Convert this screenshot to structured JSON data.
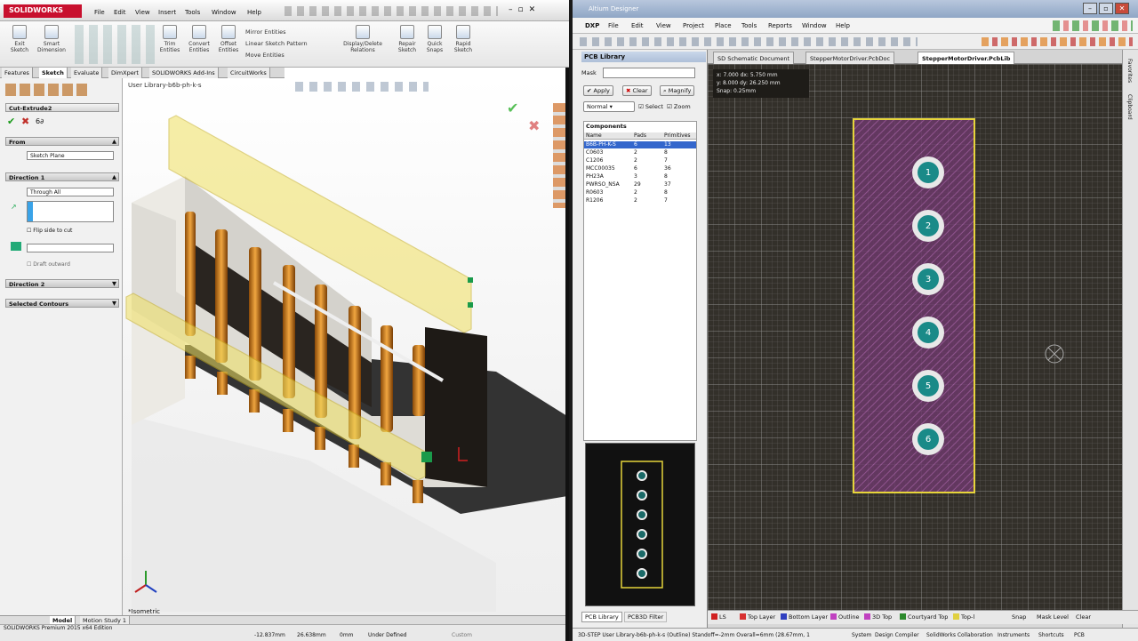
{
  "sw": {
    "logo": "SOLIDWORKS",
    "menus": [
      "File",
      "Edit",
      "View",
      "Insert",
      "Tools",
      "Window",
      "Help"
    ],
    "ribbon": [
      {
        "label": "Exit Sketch"
      },
      {
        "label": "Smart Dimension"
      },
      {
        "label": "Trim Entities"
      },
      {
        "label": "Convert Entities"
      },
      {
        "label": "Offset Entities"
      },
      {
        "label": "Mirror Entities"
      },
      {
        "label": "Linear Sketch Pattern"
      },
      {
        "label": "Move Entities"
      },
      {
        "label": "Display/Delete Relations"
      },
      {
        "label": "Repair Sketch"
      },
      {
        "label": "Quick Snaps"
      },
      {
        "label": "Rapid Sketch"
      }
    ],
    "tabs": [
      "Features",
      "Sketch",
      "Evaluate",
      "DimXpert",
      "SOLIDWORKS Add-Ins",
      "CircuitWorks"
    ],
    "feature_name": "Cut-Extrude2",
    "from_label": "From",
    "from_value": "Sketch Plane",
    "direction1_label": "Direction 1",
    "direction1_value": "Through All",
    "flip_label": "Flip side to cut",
    "draft_label": "Draft outward",
    "direction2_label": "Direction 2",
    "contours_label": "Selected Contours",
    "view_label": "*Isometric",
    "tree_label": "User Library-b6b-ph-k-s",
    "bottom_tabs": [
      "Model",
      "Motion Study 1"
    ],
    "status": [
      "SOLIDWORKS Premium 2015 x64 Edition",
      "-12.837mm",
      "26.638mm",
      "0mm",
      "Under Defined",
      "Custom"
    ]
  },
  "ad": {
    "title": "Altium Designer",
    "menus": [
      "DXP",
      "File",
      "Edit",
      "View",
      "Project",
      "Place",
      "Tools",
      "Reports",
      "Window",
      "Help"
    ],
    "panel_title": "PCB Library",
    "mask_label": "Mask",
    "buttons": [
      "Apply",
      "Clear",
      "Magnify"
    ],
    "normal": "Normal",
    "select": "Select",
    "zoom": "Zoom",
    "components_label": "Components",
    "columns": [
      "Name",
      "Pads",
      "Primitives"
    ],
    "rows": [
      {
        "name": "B6B-PH-K-S",
        "pads": "6",
        "prims": "13"
      },
      {
        "name": "C0603",
        "pads": "2",
        "prims": "8"
      },
      {
        "name": "C1206",
        "pads": "2",
        "prims": "7"
      },
      {
        "name": "MCC00035",
        "pads": "6",
        "prims": "36"
      },
      {
        "name": "PH23A",
        "pads": "3",
        "prims": "8"
      },
      {
        "name": "PWRSO_NSA",
        "pads": "29",
        "prims": "37"
      },
      {
        "name": "R0603",
        "pads": "2",
        "prims": "8"
      },
      {
        "name": "R1206",
        "pads": "2",
        "prims": "7"
      }
    ],
    "doc_tabs": [
      "SD Schematic Document",
      "StepperMotorDriver.PcbDoc",
      "StepperMotorDriver.PcbLib"
    ],
    "coord": [
      "x: 7.000   dx: 5.750 mm",
      "y: 8.000   dy: 26.250 mm",
      "Snap: 0.25mm"
    ],
    "pads": [
      "1",
      "2",
      "3",
      "4",
      "5",
      "6"
    ],
    "layers": [
      {
        "name": "LS",
        "color": "#d02020"
      },
      {
        "name": "Top Layer",
        "color": "#d83030"
      },
      {
        "name": "Bottom Layer",
        "color": "#3040c0"
      },
      {
        "name": "Outline",
        "color": "#c040c0"
      },
      {
        "name": "3D Top",
        "color": "#c040c0"
      },
      {
        "name": "Courtyard Top",
        "color": "#2c8a2c"
      },
      {
        "name": "Top-l",
        "color": "#e0d040"
      }
    ],
    "layer_right": [
      "Snap",
      "Mask Level",
      "Clear"
    ],
    "panel_tabs": [
      "PCB Library",
      "PCB3D Filter"
    ],
    "status": [
      "3D-STEP User Library-b6b-ph-k-s (Outline) Standoff=-2mm Overall=6mm (28.67mm, 1",
      "System",
      "Design Compiler",
      "SolidWorks Collaboration",
      "Instruments",
      "Shortcuts",
      "PCB"
    ],
    "side_labels": [
      "Favorites",
      "Clipboard"
    ]
  }
}
